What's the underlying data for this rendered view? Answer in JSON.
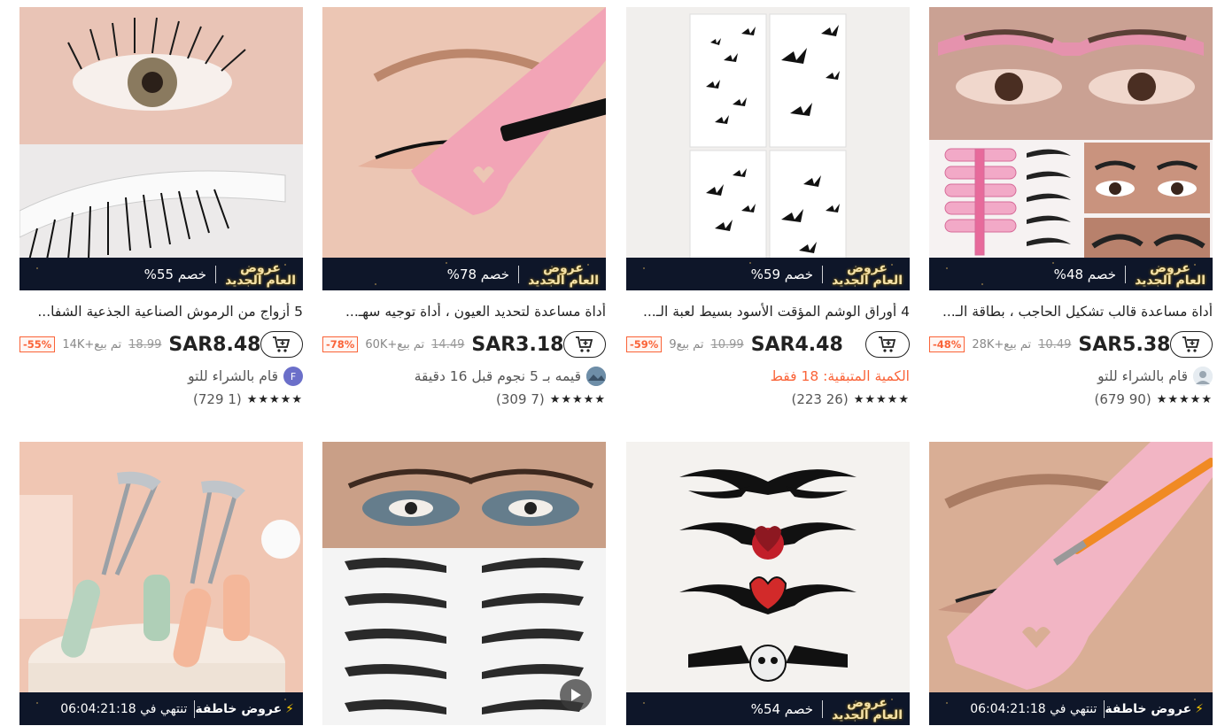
{
  "products": [
    {
      "title": "أداة مساعدة قالب تشكيل الحاجب ، بطاقة الـ...",
      "price": "SAR5.38",
      "original_price": "10.49",
      "sold": "تم بيع+28K",
      "discount_badge": "-48%",
      "banner_type": "new_year",
      "banner_brand_line1": "عروض",
      "banner_brand_line2": "العام الجديد",
      "banner_discount": "خصم 48%",
      "info_text": "قام بالشراء للتو",
      "info_style": "buyer",
      "rating_stars": "★★★★★",
      "rating_count": "(90 679)"
    },
    {
      "title": "4 أوراق الوشم المؤقت الأسود بسيط لعبة الـ...",
      "price": "SAR4.48",
      "original_price": "10.99",
      "sold": "تم بيع9",
      "discount_badge": "-59%",
      "banner_type": "new_year",
      "banner_brand_line1": "عروض",
      "banner_brand_line2": "العام الجديد",
      "banner_discount": "خصم 59%",
      "info_text": "الكمية المتبقية: 18 فقط",
      "info_style": "stock",
      "rating_stars": "★★★★★",
      "rating_count": "(26 223)"
    },
    {
      "title": "أداة مساعدة لتحديد العيون ، أداة توجيه سهـ...",
      "price": "SAR3.18",
      "original_price": "14.49",
      "sold": "تم بيع+60K",
      "discount_badge": "-78%",
      "banner_type": "new_year",
      "banner_brand_line1": "عروض",
      "banner_brand_line2": "العام الجديد",
      "banner_discount": "خصم 78%",
      "info_text": "قيمه بـ 5 نجوم قبل 16 دقيقة",
      "info_style": "review",
      "rating_stars": "★★★★★",
      "rating_count": "(7 309)"
    },
    {
      "title": "5 أزواج من الرموش الصناعية الجذعية الشفا...",
      "price": "SAR8.48",
      "original_price": "18.99",
      "sold": "تم بيع+14K",
      "discount_badge": "-55%",
      "banner_type": "new_year",
      "banner_brand_line1": "عروض",
      "banner_brand_line2": "العام الجديد",
      "banner_discount": "خصم 55%",
      "info_text": "قام بالشراء للتو",
      "info_style": "buyer_f",
      "avatar_letter": "F",
      "rating_stars": "★★★★★",
      "rating_count": "(1 729)"
    },
    {
      "banner_type": "flash",
      "banner_brand_line1": "عروض خاطفة",
      "banner_timer": "تنتهي في 06:04:21:18"
    },
    {
      "banner_type": "new_year",
      "banner_brand_line1": "عروض",
      "banner_brand_line2": "العام الجديد",
      "banner_discount": "خصم 54%"
    },
    {
      "banner_type": "none"
    },
    {
      "banner_type": "flash",
      "banner_brand_line1": "عروض خاطفة",
      "banner_timer": "تنتهي في 06:04:21:18"
    }
  ]
}
